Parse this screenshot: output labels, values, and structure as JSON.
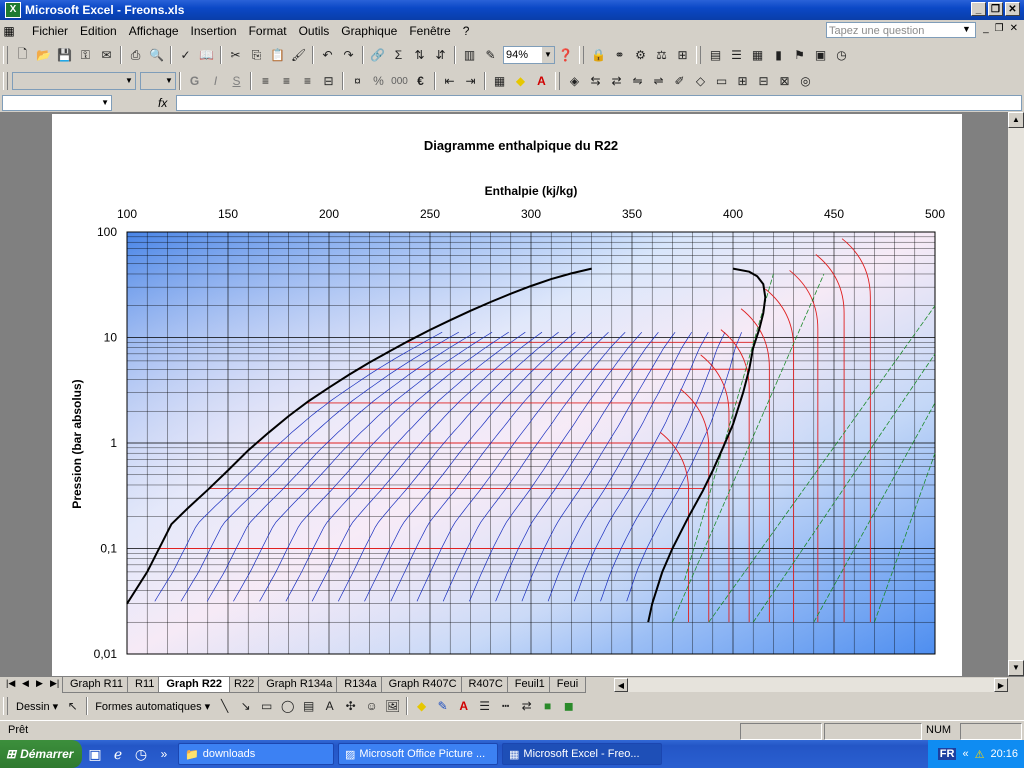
{
  "window": {
    "title": "Microsoft Excel - Freons.xls"
  },
  "menu": [
    "Fichier",
    "Edition",
    "Affichage",
    "Insertion",
    "Format",
    "Outils",
    "Graphique",
    "Fenêtre",
    "?"
  ],
  "ask_placeholder": "Tapez une question",
  "toolbar": {
    "zoom": "94%"
  },
  "font_toolbar": {
    "bold": "G",
    "italic": "I",
    "underline": "S",
    "percent": "%",
    "thousands": "000",
    "euro": "€"
  },
  "formula": {
    "fx": "fx"
  },
  "chart": {
    "title": "Diagramme enthalpique du R22",
    "x_title": "Enthalpie (kj/kg)",
    "y_title": "Pression (bar absolus)"
  },
  "chart_data": {
    "type": "line",
    "title": "Diagramme enthalpique du R22",
    "xlabel": "Enthalpie (kj/kg)",
    "ylabel": "Pression (bar absolus)",
    "xlim": [
      100,
      500
    ],
    "ylim": [
      0.01,
      100
    ],
    "y_scale": "log",
    "x_ticks": [
      "100",
      "150",
      "200",
      "250",
      "300",
      "350",
      "400",
      "450",
      "500"
    ],
    "y_ticks": [
      "0,01",
      "0,1",
      "1",
      "10",
      "100"
    ],
    "x_axis_position": "top",
    "grid": true,
    "series": [
      {
        "color": "#000000",
        "x": [
          100,
          110,
          118,
          122,
          130,
          140,
          150,
          160,
          170,
          180,
          190,
          200,
          210,
          220,
          230,
          240,
          250,
          260,
          270,
          280,
          290,
          300,
          310,
          320,
          330
        ],
        "y": [
          0.03,
          0.06,
          0.12,
          0.17,
          0.24,
          0.36,
          0.55,
          0.85,
          1.25,
          1.8,
          2.5,
          3.35,
          4.45,
          5.8,
          7.4,
          9.4,
          11.8,
          14.6,
          17.9,
          21.7,
          26.0,
          30.8,
          35.8,
          40.5,
          45.0
        ]
      },
      {
        "color": "#000000",
        "x": [
          358,
          360,
          365,
          370,
          378,
          385,
          390,
          395,
          400,
          405,
          408,
          410,
          413,
          415,
          416,
          415,
          412,
          408,
          400
        ],
        "y": [
          0.02,
          0.03,
          0.06,
          0.1,
          0.2,
          0.35,
          0.55,
          0.9,
          1.5,
          3.0,
          5.0,
          8.0,
          12.0,
          17.0,
          24.0,
          32.0,
          38.0,
          42.0,
          45.0
        ]
      }
    ]
  },
  "tabs": [
    "Graph R11",
    "R11",
    "Graph R22",
    "R22",
    "Graph R134a",
    "R134a",
    "Graph R407C",
    "R407C",
    "Feuil1",
    "Feui"
  ],
  "active_tab": "Graph R22",
  "drawbar": {
    "dessin": "Dessin",
    "formes": "Formes automatiques"
  },
  "status": {
    "left": "Prêt",
    "num": "NUM"
  },
  "taskbar": {
    "start": "Démarrer",
    "buttons": [
      "downloads",
      "Microsoft Office Picture ...",
      "Microsoft Excel - Freo..."
    ],
    "lang": "FR",
    "time": "20:16"
  }
}
